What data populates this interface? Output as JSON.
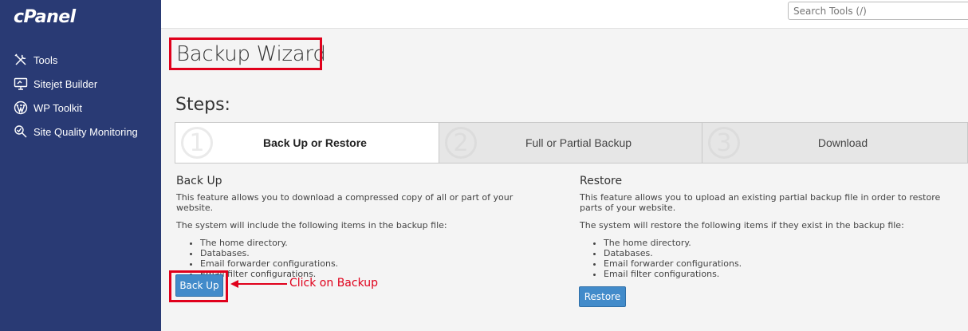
{
  "sidebar": {
    "logo": "cPanel",
    "items": [
      {
        "label": "Tools",
        "icon": "tools-icon"
      },
      {
        "label": "Sitejet Builder",
        "icon": "monitor-icon"
      },
      {
        "label": "WP Toolkit",
        "icon": "wordpress-icon"
      },
      {
        "label": "Site Quality Monitoring",
        "icon": "site-quality-icon"
      }
    ]
  },
  "header": {
    "search_placeholder": "Search Tools (/)"
  },
  "main": {
    "title": "Backup Wizard",
    "steps_heading": "Steps:",
    "steps": [
      {
        "num": "1",
        "label": "Back Up or Restore",
        "active": true
      },
      {
        "num": "2",
        "label": "Full or Partial Backup",
        "active": false
      },
      {
        "num": "3",
        "label": "Download",
        "active": false
      }
    ],
    "backup": {
      "heading": "Back Up",
      "desc": "This feature allows you to download a compressed copy of all or part of your website.",
      "intro": "The system will include the following items in the backup file:",
      "items": [
        "The home directory.",
        "Databases.",
        "Email forwarder configurations.",
        "Email filter configurations."
      ],
      "button": "Back Up"
    },
    "restore": {
      "heading": "Restore",
      "desc": "This feature allows you to upload an existing partial backup file in order to restore parts of your website.",
      "intro": "The system will restore the following items if they exist in the backup file:",
      "items": [
        "The home directory.",
        "Databases.",
        "Email forwarder configurations.",
        "Email filter configurations."
      ],
      "button": "Restore"
    },
    "annotation": "Click on Backup"
  },
  "colors": {
    "sidebar_bg": "#293a74",
    "button": "#428bca",
    "highlight": "#e0001b"
  }
}
